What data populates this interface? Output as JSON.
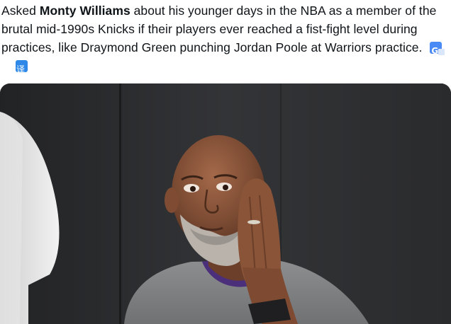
{
  "tweet": {
    "text_prefix": "Asked ",
    "text_bold": "Monty Williams",
    "text_suffix": " about his younger days in the NBA as a member of the brutal mid-1990s Knicks if their players ever reached a fist-fight level during practices, like Draymond Green punching Jordan Poole at Warriors practice.",
    "google_translate_glyph": "G",
    "translate_glyph": "译"
  },
  "icons": {
    "google_translate": "google-translate-icon",
    "translate": "translate-icon"
  },
  "colors": {
    "text": "#0f1419",
    "google_blue": "#4a8af4",
    "translate_blue": "#2d88e8"
  }
}
